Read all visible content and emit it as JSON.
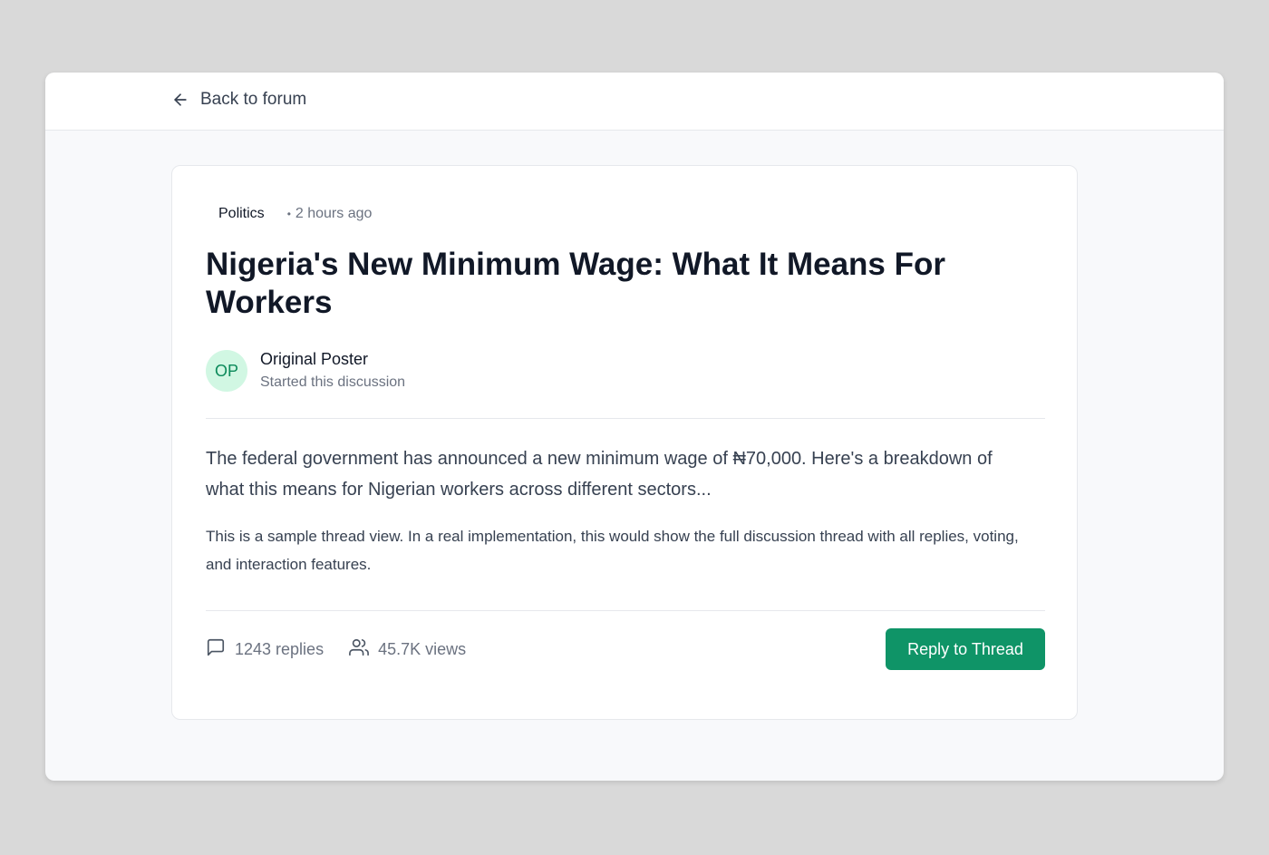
{
  "header": {
    "back_label": "Back to forum"
  },
  "thread": {
    "category": "Politics",
    "separator": "•",
    "time": "2 hours ago",
    "title": "Nigeria's New Minimum Wage: What It Means For Workers",
    "author": {
      "initials": "OP",
      "name": "Original Poster",
      "subtitle": "Started this discussion"
    },
    "lead": "The federal government has announced a new minimum wage of ₦70,000. Here's a breakdown of what this means for Nigerian workers across different sectors...",
    "body": "This is a sample thread view. In a real implementation, this would show the full discussion thread with all replies, voting, and interaction features."
  },
  "stats": {
    "replies": "1243 replies",
    "views": "45.7K views"
  },
  "actions": {
    "reply_label": "Reply to Thread"
  },
  "colors": {
    "accent": "#0f9467",
    "avatar_bg": "#d1f7e3",
    "avatar_text": "#0b8a5a",
    "page_bg": "#f8f9fb"
  },
  "icons": {
    "back": "arrow-left-icon",
    "replies": "message-square-icon",
    "views": "users-icon"
  }
}
